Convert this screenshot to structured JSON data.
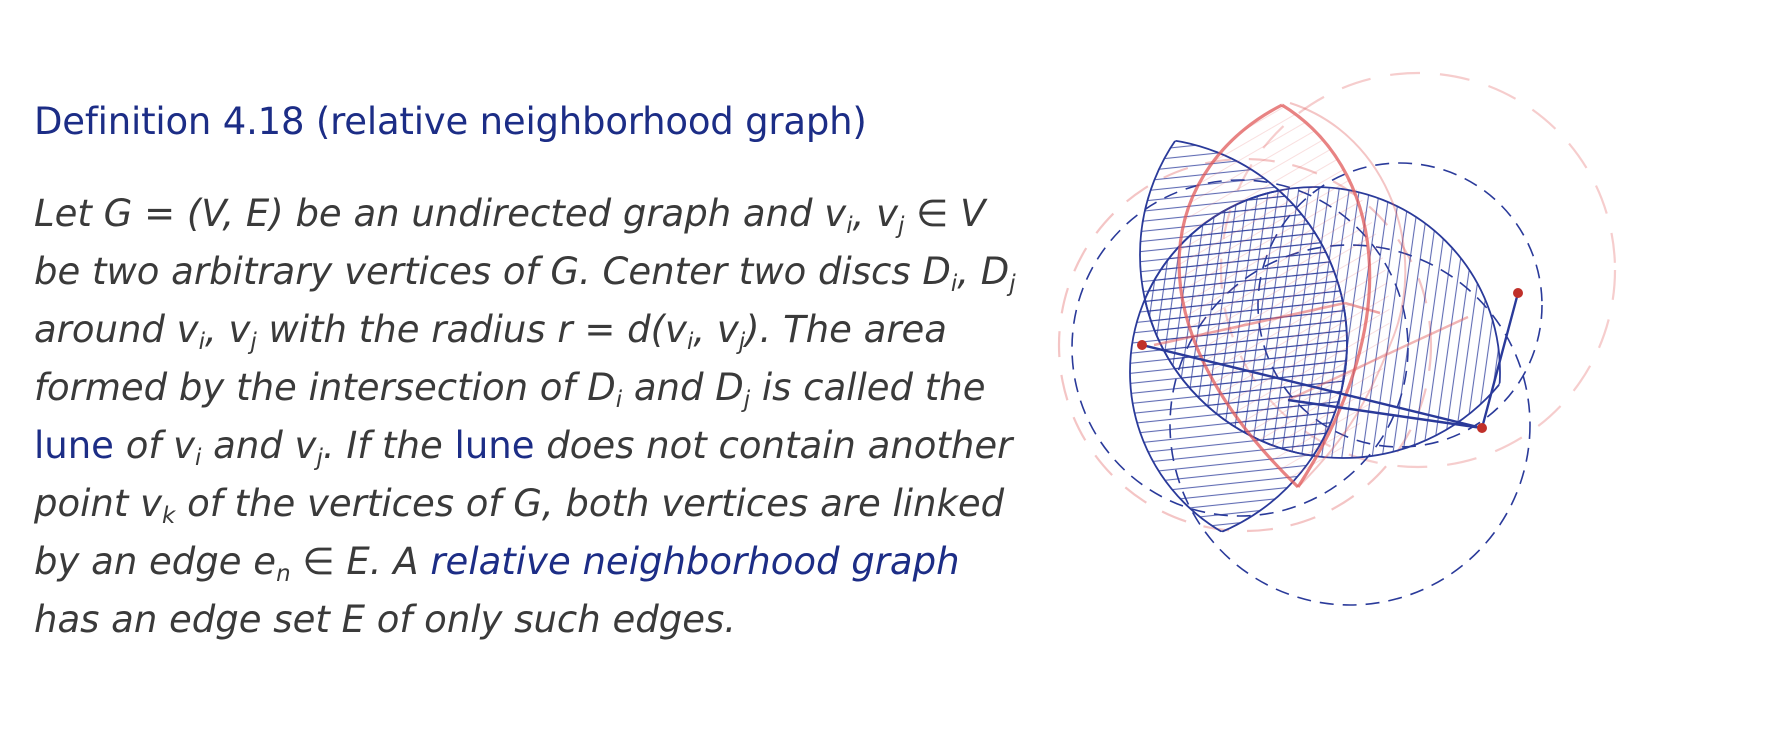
{
  "definition": {
    "title": "Definition 4.18 (relative neighborhood graph)",
    "lines": [
      [
        "Let G = (V, E) be an undirected graph and v",
        "i",
        ", v",
        "j",
        " ∈ V"
      ],
      [
        "be two arbitrary vertices of G. Center two discs D",
        "i",
        ", D",
        "j"
      ],
      [
        "around v",
        "i",
        ", v",
        "j",
        " with the radius r = d(v",
        "i",
        ", v",
        "j",
        "). The area"
      ],
      [
        "formed by the intersection of D",
        "i",
        " and D",
        "j",
        " is called the"
      ],
      [
        "lune",
        " of v",
        "i",
        " and v",
        "j",
        ". If the ",
        "lune",
        " does not contain another"
      ],
      [
        "point v",
        "k",
        " of the vertices of G, both vertices are linked"
      ],
      [
        "by an edge e",
        "n",
        " ∈ E. A ",
        "relative neighborhood graph"
      ],
      [
        "has an edge set E of only such edges."
      ]
    ]
  },
  "colors": {
    "title_blue": "#1c2d86",
    "text_gray": "#3a3a3a",
    "sketch_blue": "#2a3a9a",
    "sketch_red": "#e05a5a",
    "vertex_red": "#c0302a"
  }
}
